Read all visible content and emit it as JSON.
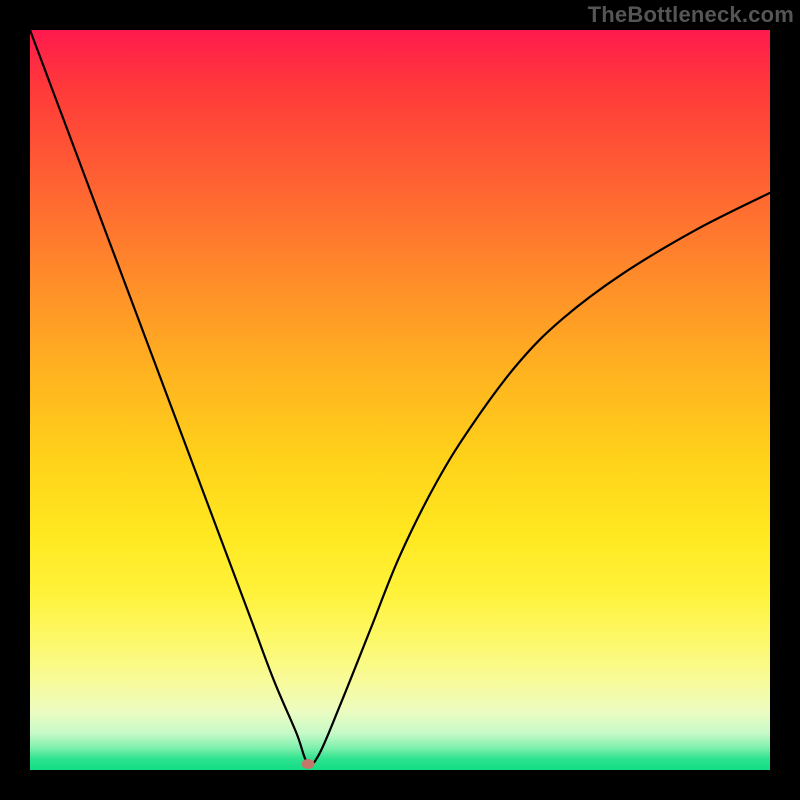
{
  "watermark": "TheBottleneck.com",
  "chart_data": {
    "type": "line",
    "title": "",
    "xlabel": "",
    "ylabel": "",
    "xlim": [
      0,
      100
    ],
    "ylim": [
      0,
      100
    ],
    "grid": false,
    "legend": false,
    "background": {
      "top_color": "#ff1a4d",
      "bottom_color": "#12dd85",
      "description": "vertical gradient red→orange→yellow→green"
    },
    "series": [
      {
        "name": "bottleneck-curve",
        "color": "#000000",
        "x": [
          0,
          3,
          6,
          9,
          12,
          15,
          18,
          21,
          24,
          27,
          30,
          33,
          36,
          37.5,
          39,
          42,
          46,
          50,
          55,
          60,
          66,
          72,
          80,
          90,
          100
        ],
        "values": [
          100,
          92,
          84,
          76,
          68,
          60,
          52,
          44,
          36,
          28,
          20,
          12,
          5,
          1,
          2,
          9,
          19,
          29,
          39,
          47,
          55,
          61,
          67,
          73,
          78
        ]
      }
    ],
    "marker": {
      "name": "optimum-point",
      "x": 37.5,
      "y": 0.8,
      "color": "#c4786a"
    }
  }
}
